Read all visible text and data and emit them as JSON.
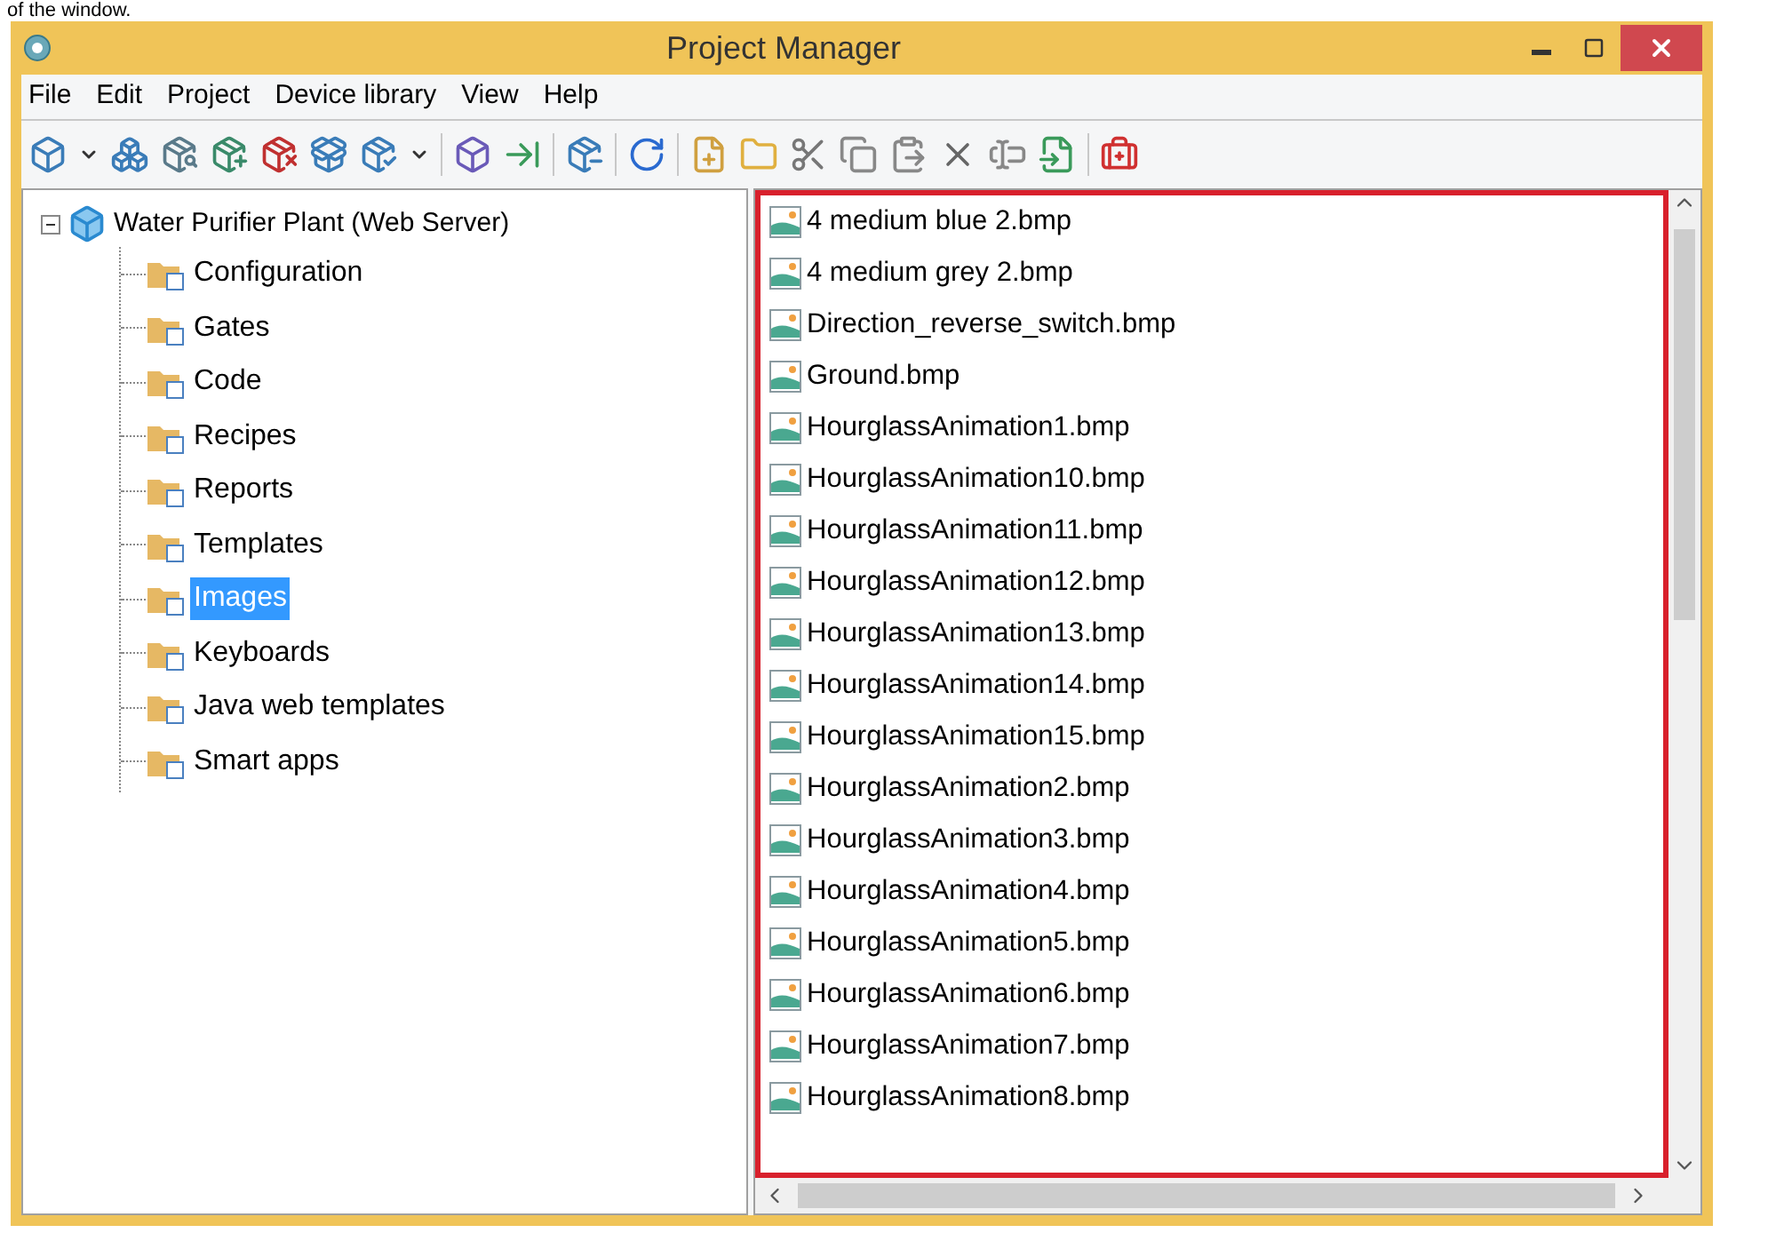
{
  "caption": "of the window.",
  "window": {
    "title": "Project Manager"
  },
  "menu": [
    "File",
    "Edit",
    "Project",
    "Device library",
    "View",
    "Help"
  ],
  "tree": {
    "label": "Water Purifier Plant (Web Server)",
    "expanded": true,
    "children": [
      {
        "label": "Configuration",
        "selected": false
      },
      {
        "label": "Gates",
        "selected": false
      },
      {
        "label": "Code",
        "selected": false
      },
      {
        "label": "Recipes",
        "selected": false
      },
      {
        "label": "Reports",
        "selected": false
      },
      {
        "label": "Templates",
        "selected": false
      },
      {
        "label": "Images",
        "selected": true
      },
      {
        "label": "Keyboards",
        "selected": false
      },
      {
        "label": "Java web templates",
        "selected": false
      },
      {
        "label": "Smart apps",
        "selected": false
      }
    ]
  },
  "files": [
    "4 medium blue 2.bmp",
    "4 medium grey 2.bmp",
    "Direction_reverse_switch.bmp",
    "Ground.bmp",
    "HourglassAnimation1.bmp",
    "HourglassAnimation10.bmp",
    "HourglassAnimation11.bmp",
    "HourglassAnimation12.bmp",
    "HourglassAnimation13.bmp",
    "HourglassAnimation14.bmp",
    "HourglassAnimation15.bmp",
    "HourglassAnimation2.bmp",
    "HourglassAnimation3.bmp",
    "HourglassAnimation4.bmp",
    "HourglassAnimation5.bmp",
    "HourglassAnimation6.bmp",
    "HourglassAnimation7.bmp",
    "HourglassAnimation8.bmp"
  ]
}
